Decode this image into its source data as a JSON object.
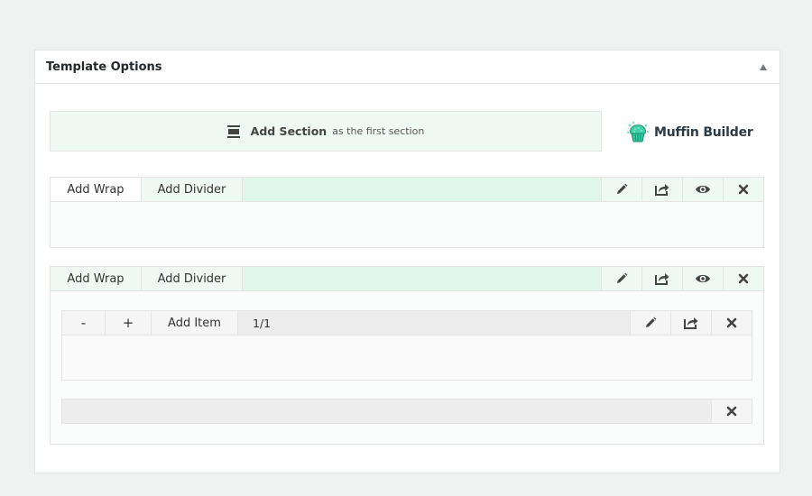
{
  "panel": {
    "title": "Template Options",
    "collapse_icon": "triangle-up-icon"
  },
  "add_section": {
    "icon": "section-icon",
    "bold_label": "Add Section",
    "rest_label": "as the first section"
  },
  "logo": {
    "text": "Muffin Builder",
    "icon": "muffin-icon",
    "color": "#2dc69a"
  },
  "sections": [
    {
      "tabs": [
        "Add Wrap",
        "Add Divider"
      ],
      "active_tab": 0,
      "actions": [
        "pencil-icon",
        "share-icon",
        "eye-icon",
        "close-icon"
      ]
    },
    {
      "tabs": [
        "Add Wrap",
        "Add Divider"
      ],
      "active_tab": null,
      "actions": [
        "pencil-icon",
        "share-icon",
        "eye-icon",
        "close-icon"
      ],
      "wrap": {
        "decrease_label": "-",
        "increase_label": "+",
        "add_item_label": "Add Item",
        "size": "1/1",
        "actions": [
          "pencil-icon",
          "share-icon",
          "close-icon"
        ]
      },
      "divider": {
        "actions": [
          "close-icon"
        ]
      }
    }
  ],
  "colors": {
    "section_bar": "#dff7eb",
    "tab_bg": "#eff9f4",
    "icon": "#444444"
  }
}
